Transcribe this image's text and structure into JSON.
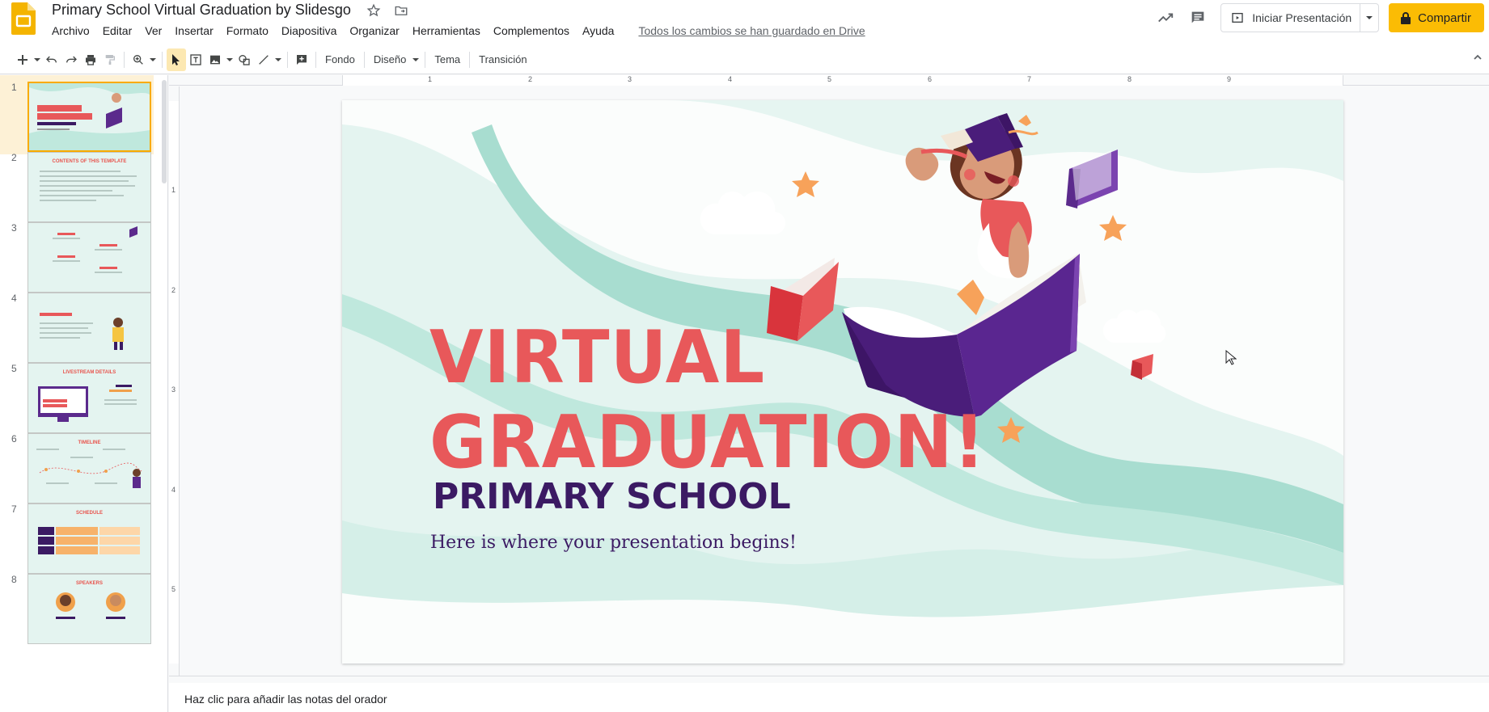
{
  "doc": {
    "title": "Primary School Virtual Graduation by Slidesgo",
    "saved_status": "Todos los cambios se han guardado en Drive"
  },
  "menu": [
    "Archivo",
    "Editar",
    "Ver",
    "Insertar",
    "Formato",
    "Diapositiva",
    "Organizar",
    "Herramientas",
    "Complementos",
    "Ayuda"
  ],
  "header_actions": {
    "present_label": "Iniciar Presentación",
    "share_label": "Compartir"
  },
  "toolbar": {
    "fondo": "Fondo",
    "diseno": "Diseño",
    "tema": "Tema",
    "transicion": "Transición"
  },
  "ruler": {
    "h": [
      "1",
      "2",
      "3",
      "4",
      "5",
      "6",
      "7",
      "8",
      "9"
    ],
    "v": [
      "1",
      "2",
      "3",
      "4",
      "5"
    ]
  },
  "slides": [
    {
      "num": "1",
      "title": "VIRTUAL GRADUATION!"
    },
    {
      "num": "2",
      "title": "CONTENTS OF THIS TEMPLATE"
    },
    {
      "num": "3",
      "title": "01. INTRODUCTION"
    },
    {
      "num": "4",
      "title": "INTRODUCTION"
    },
    {
      "num": "5",
      "title": "LIVESTREAM DETAILS"
    },
    {
      "num": "6",
      "title": "TIMELINE"
    },
    {
      "num": "7",
      "title": "SCHEDULE"
    },
    {
      "num": "8",
      "title": "SPEAKERS"
    }
  ],
  "current_slide": {
    "title_line1": "VIRTUAL",
    "title_line2": "GRADUATION!",
    "subtitle": "PRIMARY SCHOOL",
    "body": "Here is where your presentation begins!"
  },
  "notes_placeholder": "Haz clic para añadir las notas del orador",
  "colors": {
    "accent_yellow": "#fbbc04",
    "title_red": "#e8585a",
    "purple": "#3b1a63",
    "mint": "#a8ddd0"
  }
}
